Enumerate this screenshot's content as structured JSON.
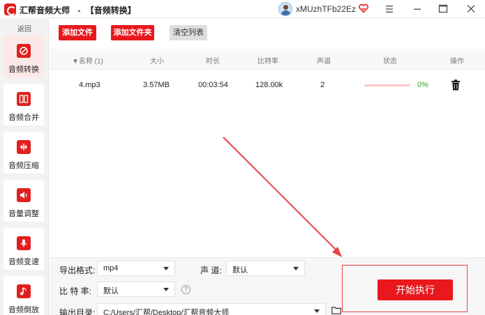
{
  "window": {
    "app_name": "汇帮音频大师",
    "title_separator": "-",
    "section": "【音频转换】",
    "username": "xMUzhTFb22Ez"
  },
  "sidebar": {
    "back_label": "返回",
    "items": [
      {
        "label": "音频转换",
        "icon": "convert-icon",
        "active": true
      },
      {
        "label": "音频合并",
        "icon": "merge-icon",
        "active": false
      },
      {
        "label": "音频压缩",
        "icon": "compress-icon",
        "active": false
      },
      {
        "label": "音量调整",
        "icon": "volume-icon",
        "active": false
      },
      {
        "label": "音频变速",
        "icon": "speed-icon",
        "active": false
      },
      {
        "label": "音频倒放",
        "icon": "reverse-icon",
        "active": false
      }
    ]
  },
  "toolbar": {
    "add_file": "添加文件",
    "add_folder": "添加文件夹",
    "clear_list": "清空列表"
  },
  "table": {
    "headers": {
      "name": "名称 (1)",
      "size": "大小",
      "duration": "时长",
      "bitrate": "比特率",
      "channels": "声道",
      "status": "状态",
      "actions": "操作"
    },
    "rows": [
      {
        "name": "4.mp3",
        "size": "3.57MB",
        "duration": "00:03:54",
        "bitrate": "128.00k",
        "channels": "2",
        "progress": 0,
        "status_text": "0%"
      }
    ]
  },
  "settings": {
    "format_label": "导出格式:",
    "format_value": "mp4",
    "channel_label": "声 道:",
    "channel_value": "默认",
    "bitrate_label": "比 特 率:",
    "bitrate_value": "默认",
    "output_label": "输出目录:",
    "output_value": "C:/Users/汇帮/Desktop/汇帮音频大师",
    "help_glyph": "?"
  },
  "start_button": "开始执行",
  "colors": {
    "accent": "#e8181c",
    "status_ok": "#2aa52a",
    "annotation": "#e84242"
  }
}
